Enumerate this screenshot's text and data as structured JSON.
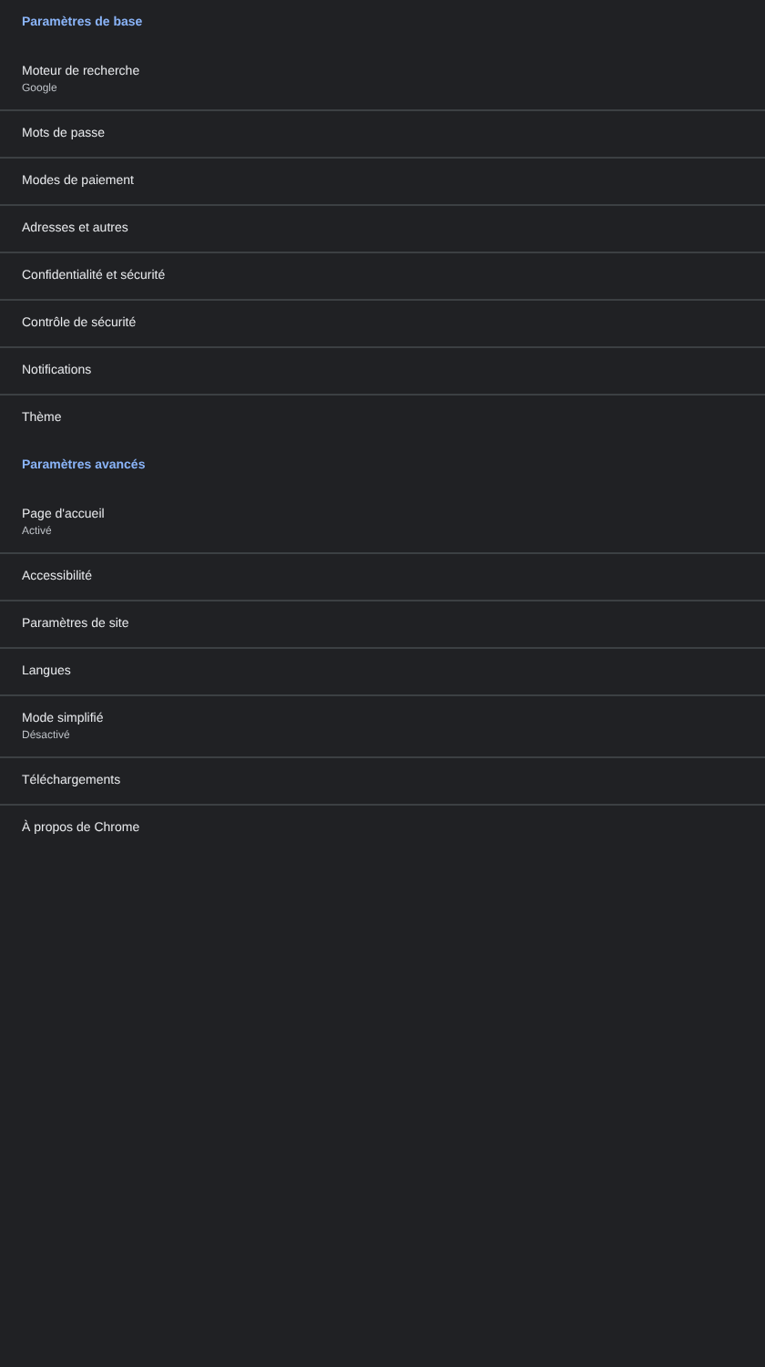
{
  "sections": [
    {
      "title": "Paramètres de base",
      "items": [
        {
          "label": "Moteur de recherche",
          "summary": "Google"
        },
        {
          "label": "Mots de passe"
        },
        {
          "label": "Modes de paiement"
        },
        {
          "label": "Adresses et autres"
        },
        {
          "label": "Confidentialité et sécurité"
        },
        {
          "label": "Contrôle de sécurité"
        },
        {
          "label": "Notifications"
        },
        {
          "label": "Thème"
        }
      ]
    },
    {
      "title": "Paramètres avancés",
      "items": [
        {
          "label": "Page d'accueil",
          "summary": "Activé"
        },
        {
          "label": "Accessibilité"
        },
        {
          "label": "Paramètres de site"
        },
        {
          "label": "Langues"
        },
        {
          "label": "Mode simplifié",
          "summary": "Désactivé"
        },
        {
          "label": "Téléchargements"
        },
        {
          "label": "À propos de Chrome"
        }
      ]
    }
  ]
}
